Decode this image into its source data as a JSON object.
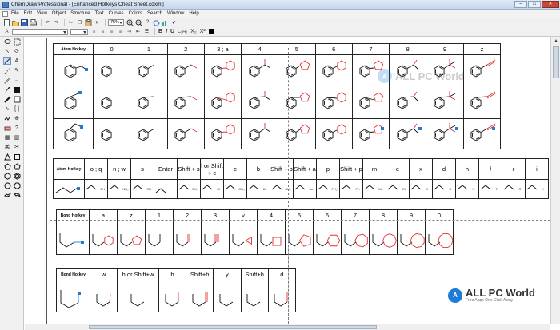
{
  "window": {
    "title": "ChemDraw Professional - [Enhanced Hotkeys Cheat Sheet.cdxml]",
    "min": "–",
    "max": "□",
    "close": "✕"
  },
  "menu": [
    "File",
    "Edit",
    "View",
    "Object",
    "Structure",
    "Text",
    "Curves",
    "Colors",
    "Search",
    "Window",
    "Help"
  ],
  "toolbar": {
    "zoom_value": "75%",
    "font_value": "",
    "size_value": "",
    "bold": "B",
    "italic": "I",
    "underline": "U",
    "subscript": "X₂",
    "superscript": "X²",
    "formula": "C₂H₂"
  },
  "tables": {
    "atom": {
      "corner": "Atom Hotkey",
      "keys": [
        "0",
        "1",
        "2",
        "3 ; a",
        "4",
        "5",
        "6",
        "7",
        "8",
        "9",
        "z"
      ]
    },
    "atom2": {
      "corner": "Atom Hotkey",
      "keys": [
        "o ; q",
        "n ; w",
        "s",
        "Enter",
        "Shift + s",
        "l or Shift + c",
        "c",
        "b",
        "Shift + b",
        "Shift + a",
        "p",
        "Shift + p",
        "m",
        "e",
        "x",
        "d",
        "h",
        "f",
        "r",
        "i"
      ],
      "labels": [
        "",
        "OH",
        "NH₂",
        "SH",
        "",
        "SiH₃",
        "Cl",
        "CH₃",
        "Br",
        "BH₂",
        "Ac",
        "PH₂",
        "Ph",
        "Me",
        "Et",
        "X",
        "D",
        "H",
        "F",
        "R",
        "I"
      ]
    },
    "bond": {
      "corner": "Bond Hotkey",
      "keys": [
        "a",
        "z",
        "1",
        "2",
        "3",
        "v",
        "4",
        "5",
        "6",
        "7",
        "8",
        "9",
        "0"
      ]
    },
    "bond2": {
      "corner": "Bond Hotkey",
      "keys": [
        "w",
        "h or Shift+w",
        "b",
        "Shift+b",
        "y",
        "Shift+h",
        "d"
      ]
    }
  },
  "watermarks": [
    {
      "name": "ALL PC World",
      "tag": "Free Apps One Click Away",
      "mark": "A"
    }
  ],
  "colors": {
    "accent": "#e53030",
    "highlight": "#1e7bd6",
    "ink": "#111111"
  }
}
